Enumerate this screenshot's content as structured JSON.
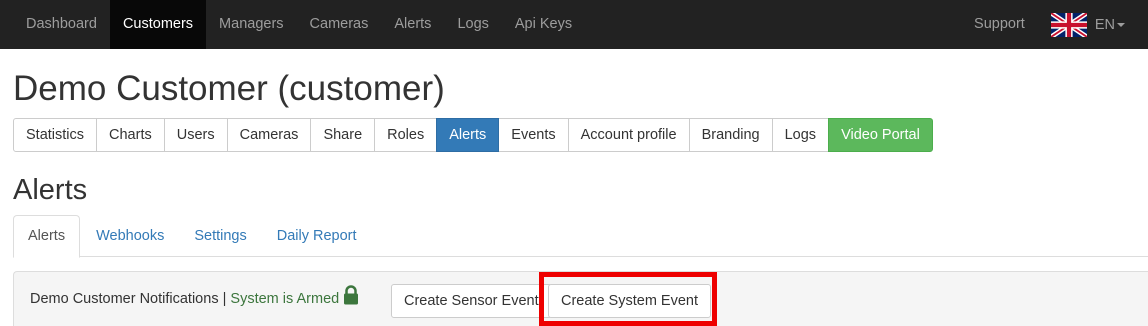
{
  "navbar": {
    "items": [
      {
        "label": "Dashboard",
        "active": false
      },
      {
        "label": "Customers",
        "active": true
      },
      {
        "label": "Managers",
        "active": false
      },
      {
        "label": "Cameras",
        "active": false
      },
      {
        "label": "Alerts",
        "active": false
      },
      {
        "label": "Logs",
        "active": false
      },
      {
        "label": "Api Keys",
        "active": false
      }
    ],
    "support_label": "Support",
    "language_label": "EN",
    "language_icon": "uk-flag-icon",
    "background_color": "#222222"
  },
  "page": {
    "title": "Demo Customer (customer)"
  },
  "customer_tabs": {
    "items": [
      {
        "label": "Statistics",
        "style": "default"
      },
      {
        "label": "Charts",
        "style": "default"
      },
      {
        "label": "Users",
        "style": "default"
      },
      {
        "label": "Cameras",
        "style": "default"
      },
      {
        "label": "Share",
        "style": "default"
      },
      {
        "label": "Roles",
        "style": "default"
      },
      {
        "label": "Alerts",
        "style": "primary"
      },
      {
        "label": "Events",
        "style": "default"
      },
      {
        "label": "Account profile",
        "style": "default"
      },
      {
        "label": "Branding",
        "style": "default"
      },
      {
        "label": "Logs",
        "style": "default"
      },
      {
        "label": "Video Portal",
        "style": "success"
      }
    ],
    "primary_color": "#337ab7",
    "success_color": "#5cb85c"
  },
  "section": {
    "title": "Alerts"
  },
  "alert_tabs": {
    "items": [
      {
        "label": "Alerts",
        "active": true
      },
      {
        "label": "Webhooks",
        "active": false
      },
      {
        "label": "Settings",
        "active": false
      },
      {
        "label": "Daily Report",
        "active": false
      }
    ],
    "link_color": "#337ab7"
  },
  "panel": {
    "notifications_label": "Demo Customer Notifications",
    "separator": "|",
    "status_text": "System is Armed",
    "status_color": "#3c763d",
    "status_icon": "lock-icon",
    "create_sensor_event_label": "Create Sensor Event",
    "create_system_event_label": "Create System Event",
    "highlight_color": "#ee0000"
  }
}
